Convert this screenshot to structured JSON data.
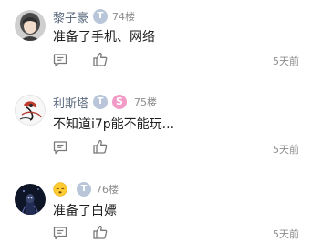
{
  "comments": [
    {
      "username": "黎子豪",
      "badge": "T",
      "floor": "74楼",
      "text": "准备了手机、网络",
      "time": "5天前"
    },
    {
      "username": "利斯塔",
      "badge": "T",
      "badge2": "S",
      "floor": "75楼",
      "text": "不知道i7p能不能玩...",
      "time": "5天前"
    },
    {
      "username": "",
      "badge": "T",
      "floor": "76楼",
      "text": "准备了白嫖",
      "time": "5天前"
    }
  ],
  "colors": {
    "username": "#5c6b7f",
    "badge_t": "#b9c6da",
    "badge_s": "#f29bc7",
    "floor": "#8c8c8c",
    "icon": "#7a7a7a"
  },
  "icons": {
    "reply": "comment-bubble-icon",
    "like": "thumbs-up-icon",
    "emoji": "sleepy-face-emoji-icon"
  }
}
